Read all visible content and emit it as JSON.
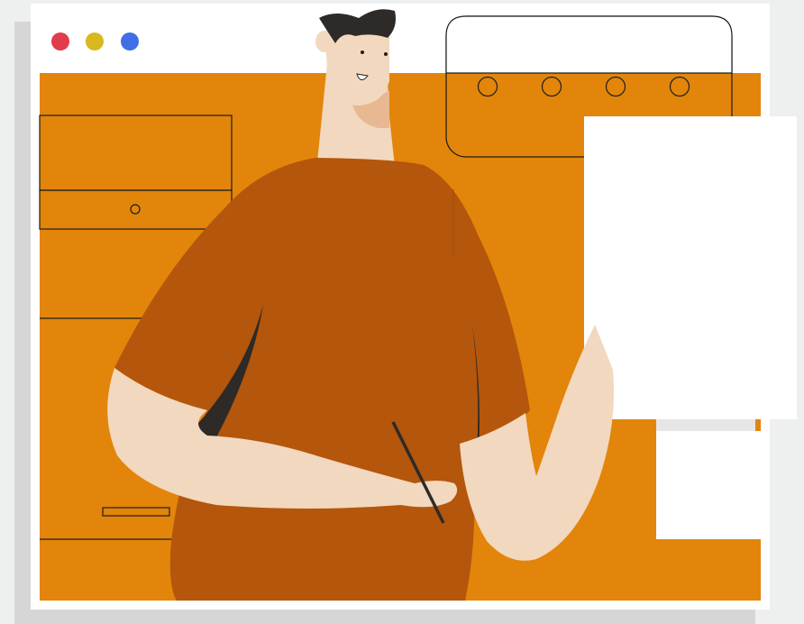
{
  "window": {
    "controls": [
      {
        "name": "close",
        "color": "#e03c4a"
      },
      {
        "name": "minimize",
        "color": "#d9b81f"
      },
      {
        "name": "maximize",
        "color": "#3f6ee6"
      }
    ]
  },
  "colors": {
    "background": "#eeefef",
    "shadow": "#d6d6d6",
    "window": "#ffffff",
    "canvas_orange": "#e2850a",
    "shirt": "#b4560b",
    "skin": "#f2d8be",
    "skin_shadow": "#e8b892",
    "hair": "#2d2a28",
    "outline": "#1d1d1d"
  },
  "icons": {
    "window_controls": [
      "close-dot-icon",
      "minimize-dot-icon",
      "maximize-dot-icon"
    ],
    "figure": "person-with-stylus-illustration"
  }
}
